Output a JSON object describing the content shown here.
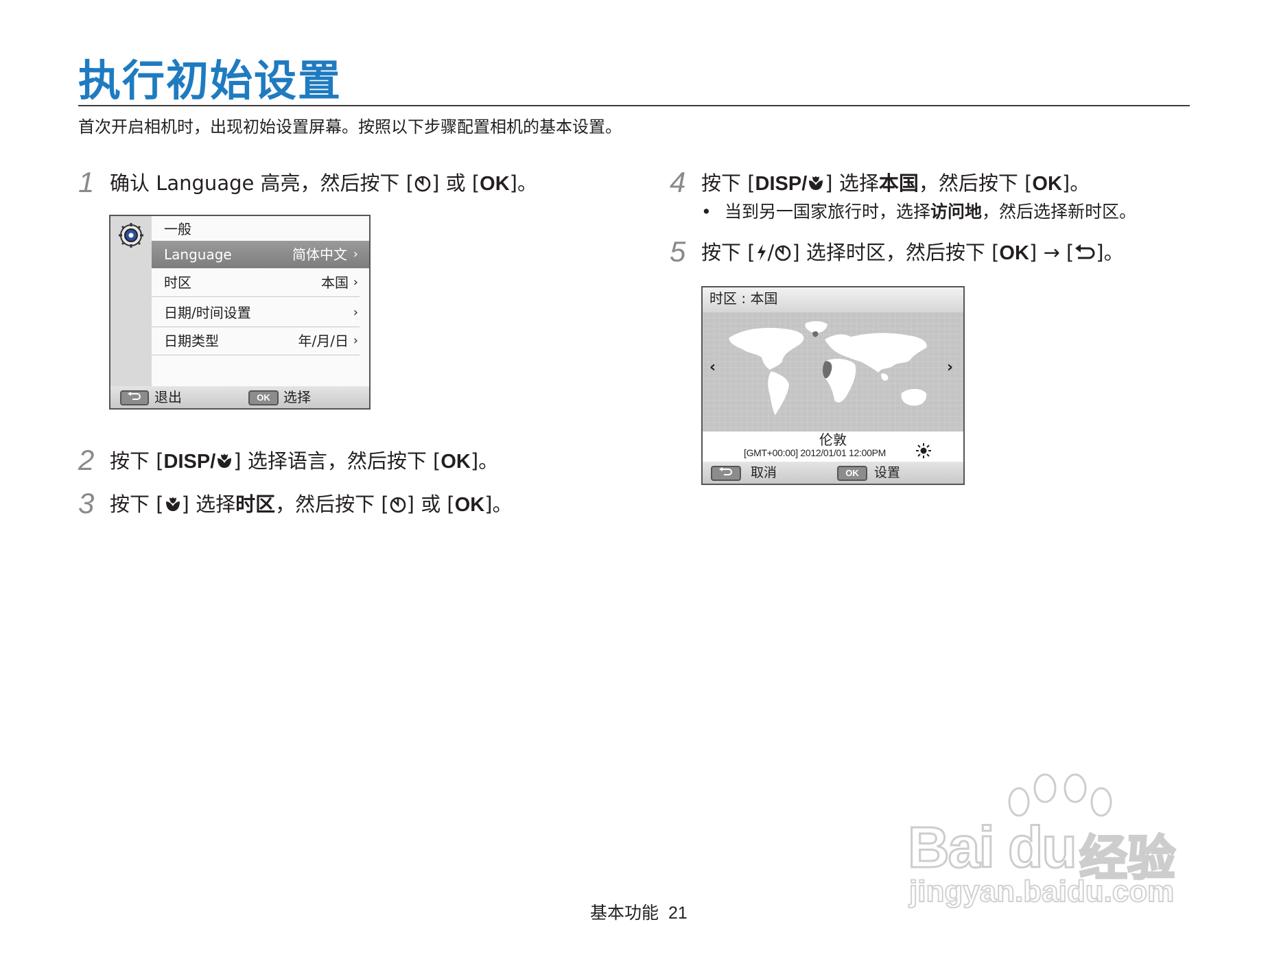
{
  "title": "执行初始设置",
  "intro": "首次开启相机时，出现初始设置屏幕。按照以下步骤配置相机的基本设置。",
  "steps": [
    {
      "num": "1",
      "pre": "确认 Language 高亮，然后按下 [",
      "mid": "] 或 [",
      "key": "OK",
      "post": "]。"
    },
    {
      "num": "2",
      "pre": "按下 [",
      "key1": "DISP/",
      "mid": "] 选择语言，然后按下 [",
      "key": "OK",
      "post": "]。"
    },
    {
      "num": "3",
      "pre": "按下 [",
      "mid": "] 选择",
      "bold": "时区",
      "mid2": "，然后按下 [",
      "mid3": "] 或 [",
      "key": "OK",
      "post": "]。"
    },
    {
      "num": "4",
      "pre": "按下 [",
      "key1": "DISP/",
      "mid": "] 选择",
      "bold": "本国",
      "mid2": "，然后按下 [",
      "key": "OK",
      "post": "]。"
    },
    {
      "num": "5",
      "pre": "按下 [",
      "mid": "/",
      "mid2": "] 选择时区，然后按下 [",
      "key": "OK",
      "mid3": "] → [",
      "post": "]。"
    }
  ],
  "step4_bullet": {
    "dot": "•",
    "pre": "当到另一国家旅行时，选择",
    "bold": "访问地",
    "post": "，然后选择新时区。"
  },
  "screen1": {
    "header": "一般",
    "rows": [
      {
        "label": "Language",
        "value": "简体中文",
        "chev": "›"
      },
      {
        "label": "时区",
        "value": "本国",
        "chev": "›"
      },
      {
        "label": "日期/时间设置",
        "value": "",
        "chev": "›"
      },
      {
        "label": "日期类型",
        "value": "年/月/日",
        "chev": "›"
      }
    ],
    "back_label": "退出",
    "ok_key": "OK",
    "ok_label": "选择"
  },
  "screen2": {
    "header": "时区 : 本国",
    "city": "伦敦",
    "gmt": "[GMT+00:00] 2012/01/01 12:00PM",
    "left_arrow": "‹",
    "right_arrow": "›",
    "back_label": "取消",
    "ok_key": "OK",
    "ok_label": "设置"
  },
  "footer": {
    "section": "基本功能",
    "page": "21"
  },
  "watermark": {
    "brand": "Bai du",
    "cn": "经验",
    "url": "jingyan.baidu.com"
  },
  "colors": {
    "title": "#1f7bc0",
    "step_number": "#8a8a8a",
    "highlight": "#888888"
  }
}
